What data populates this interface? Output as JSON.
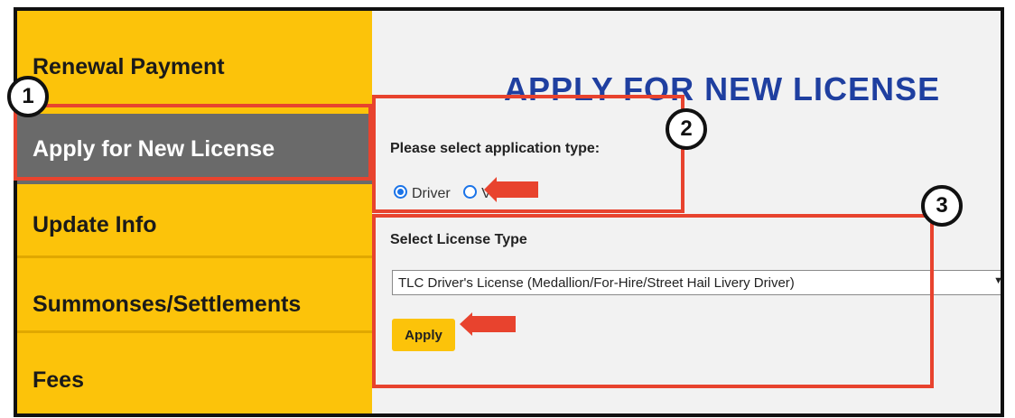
{
  "sidebar": {
    "items": [
      {
        "label": "Renewal Payment"
      },
      {
        "label": "Apply for New License"
      },
      {
        "label": "Update Info"
      },
      {
        "label": "Summonses/Settlements"
      },
      {
        "label": "Fees"
      }
    ]
  },
  "main": {
    "title": "APPLY FOR NEW LICENSE",
    "application_type_label": "Please select application type:",
    "options": [
      {
        "label": "Driver",
        "selected": true
      },
      {
        "label": "Vehicle",
        "selected": false
      }
    ],
    "license_type_label": "Select License Type",
    "license_select_value": "TLC Driver's License (Medallion/For-Hire/Street Hail Livery Driver)",
    "apply_label": "Apply"
  },
  "callouts": [
    "1",
    "2",
    "3"
  ],
  "colors": {
    "sidebar_bg": "#fcc30a",
    "active_bg": "#6a6a6a",
    "title": "#1f3fa0",
    "highlight": "#e8432e",
    "radio": "#1a73e8"
  }
}
